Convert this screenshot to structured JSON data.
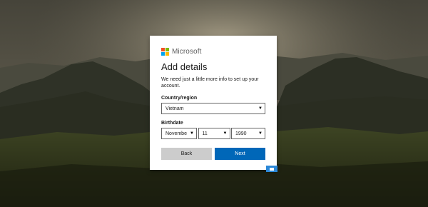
{
  "brand": {
    "name": "Microsoft",
    "logo_colors": [
      "#f25022",
      "#7fba00",
      "#00a4ef",
      "#ffb900"
    ]
  },
  "form": {
    "title": "Add details",
    "description": "We need just a little more info to set up your account.",
    "country_label": "Country/region",
    "country_value": "Vietnam",
    "birthdate_label": "Birthdate",
    "birth_month": "Novembe",
    "birth_day": "11",
    "birth_year": "1990"
  },
  "buttons": {
    "back": "Back",
    "next": "Next"
  },
  "colors": {
    "accent": "#0067b8",
    "back_button": "#cccccc"
  },
  "icons": {
    "dropdown": "chevron-down-icon",
    "feedback": "feedback-icon"
  }
}
